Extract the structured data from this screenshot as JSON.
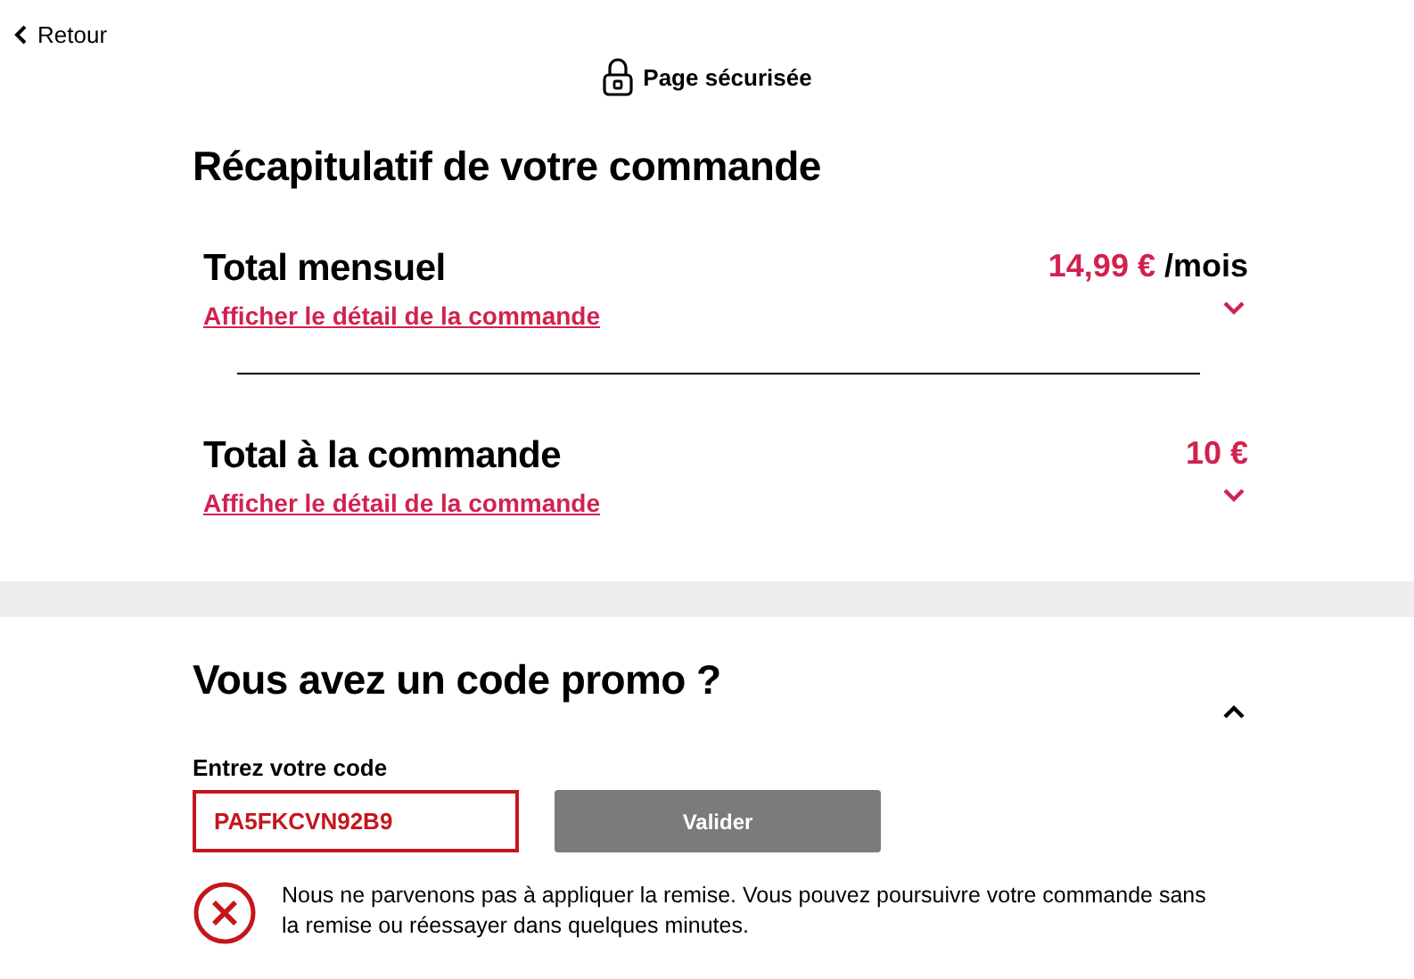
{
  "back_link": {
    "label": "Retour"
  },
  "secure_badge": {
    "label": "Page sécurisée"
  },
  "summary": {
    "title": "Récapitulatif de votre commande",
    "totals": [
      {
        "label": "Total mensuel",
        "amount": "14,99 €",
        "suffix": "/mois",
        "link": "Afficher le détail de la commande",
        "expanded": false
      },
      {
        "label": "Total à la commande",
        "amount": "10 €",
        "link": "Afficher le détail de la commande",
        "expanded": false
      }
    ]
  },
  "promo": {
    "title": "Vous avez un code promo ?",
    "expanded": true,
    "field_label": "Entrez votre code",
    "value": "PA5FKCVN92B9",
    "invalid": true,
    "button": {
      "label": "Valider",
      "disabled": true
    },
    "error": "Nous ne parvenons pas à appliquer la remise. Vous pouvez poursuivre votre commande sans la remise ou réessayer dans quelques minutes."
  }
}
